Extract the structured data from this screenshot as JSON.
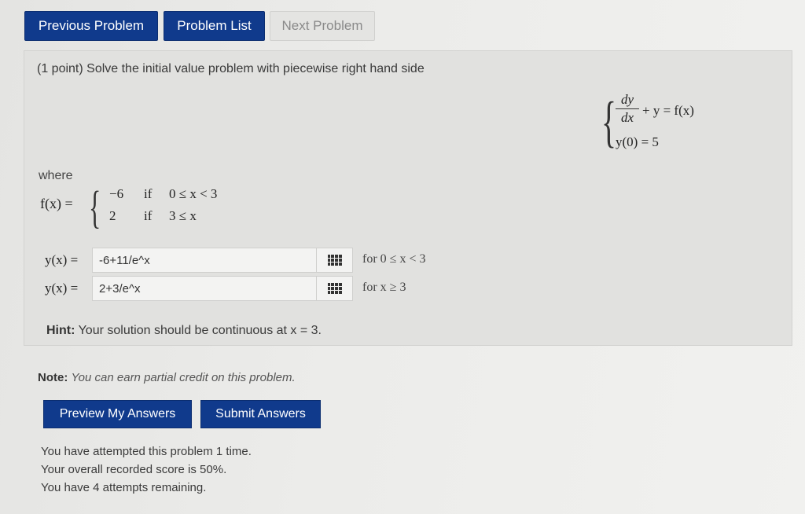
{
  "nav": {
    "previous": "Previous Problem",
    "list": "Problem List",
    "next": "Next Problem"
  },
  "problem": {
    "intro": "(1 point) Solve the initial value problem with piecewise right hand side",
    "system": {
      "numerator": "dy",
      "denominator": "dx",
      "eq1_rest": "+ y = f(x)",
      "eq2": "y(0) = 5"
    },
    "where": "where",
    "f_label": "f(x) =",
    "cases": [
      {
        "value": "−6",
        "keyword": "if",
        "condition": "0 ≤ x < 3"
      },
      {
        "value": "2",
        "keyword": "if",
        "condition": "3 ≤ x"
      }
    ],
    "answers": [
      {
        "label": "y(x) =",
        "value": "-6+11/e^x",
        "domain": "for 0 ≤ x < 3"
      },
      {
        "label": "y(x) =",
        "value": "2+3/e^x",
        "domain": "for x ≥ 3"
      }
    ],
    "hint_label": "Hint:",
    "hint_text": "Your solution should be continuous at x = 3."
  },
  "note": {
    "label": "Note:",
    "text": "You can earn partial credit on this problem."
  },
  "actions": {
    "preview": "Preview My Answers",
    "submit": "Submit Answers"
  },
  "status": [
    "You have attempted this problem 1 time.",
    "Your overall recorded score is 50%.",
    "You have 4 attempts remaining."
  ],
  "colors": {
    "primary_button": "#103a8c",
    "panel_background": "#e1e1df"
  }
}
